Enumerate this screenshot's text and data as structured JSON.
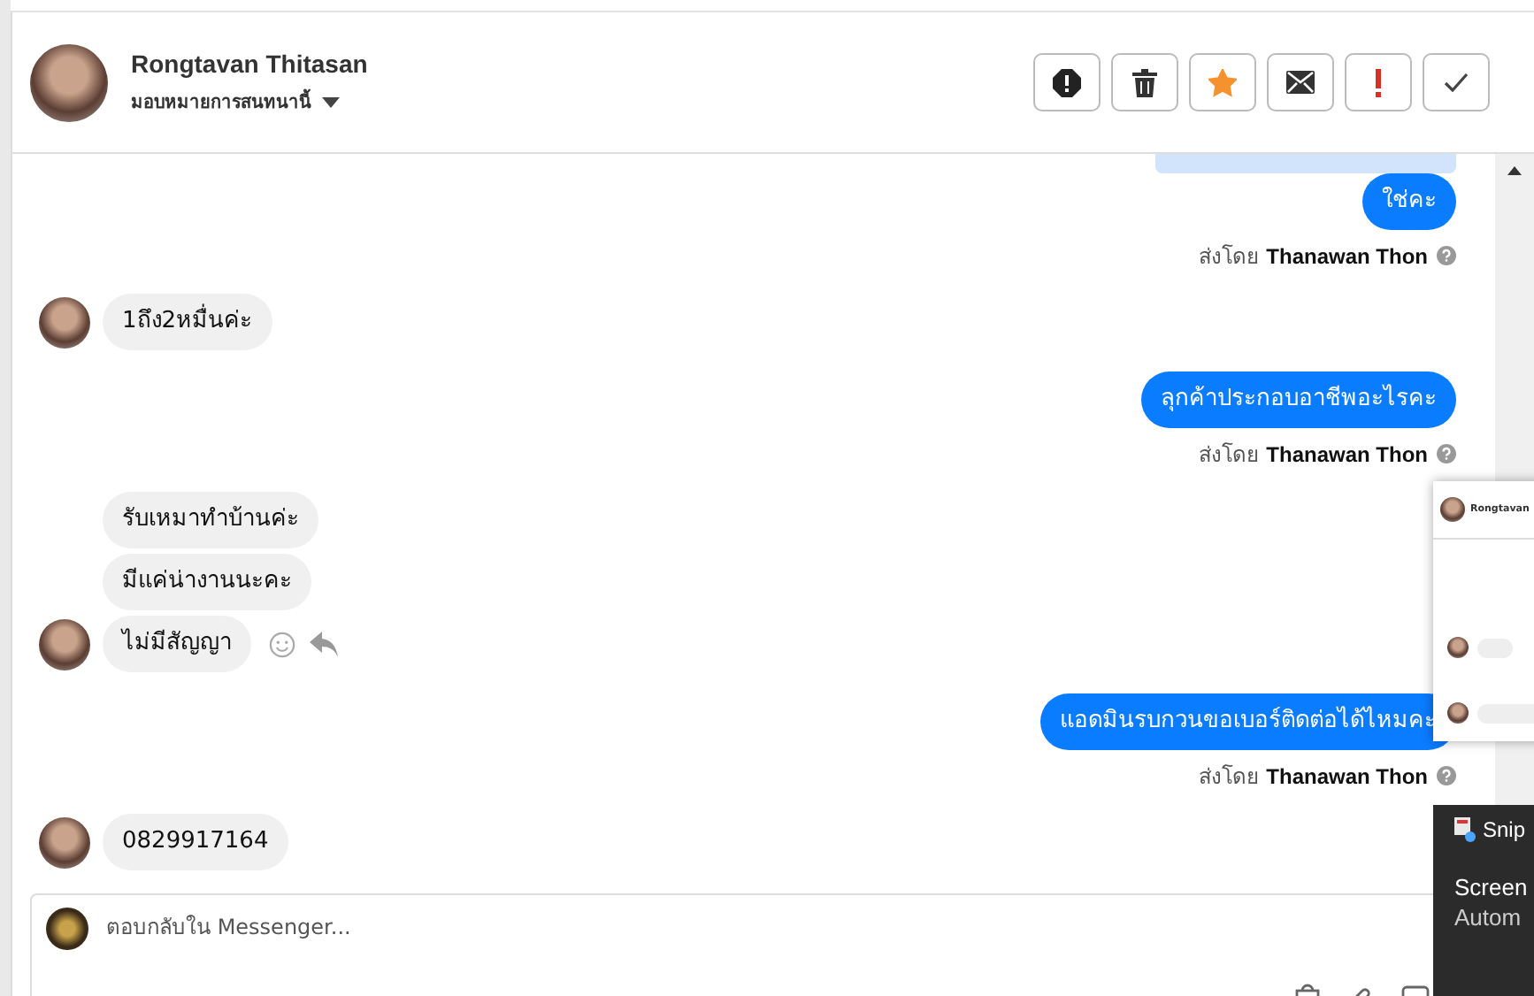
{
  "header": {
    "name": "Rongtavan Thitasan",
    "assign_label": "มอบหมายการสนทนานี้"
  },
  "toolbar": [
    {
      "kind": "spam"
    },
    {
      "kind": "trash"
    },
    {
      "kind": "star",
      "on": true
    },
    {
      "kind": "mail"
    },
    {
      "kind": "important"
    },
    {
      "kind": "done"
    }
  ],
  "messages": [
    {
      "kind": "out",
      "text": "ใช่คะ",
      "sent_by": {
        "label": "ส่งโดย",
        "name": "Thanawan Thon"
      }
    },
    {
      "kind": "in",
      "text": "1ถึง2หมื่นค่ะ",
      "avatar": true
    },
    {
      "kind": "out",
      "text": "ลุกค้าประกอบอาชีพอะไรคะ",
      "sent_by": {
        "label": "ส่งโดย",
        "name": "Thanawan Thon"
      }
    },
    {
      "kind": "in",
      "text": "รับเหมาทำบ้านค่ะ",
      "avatar": false
    },
    {
      "kind": "in",
      "text": "มีแค่น่างานนะคะ",
      "avatar": false
    },
    {
      "kind": "in",
      "text": "ไม่มีสัญญา",
      "avatar": true,
      "actions": true
    },
    {
      "kind": "out",
      "text": "แอดมินรบกวนขอเบอร์ติดต่อได้ไหมคะ",
      "sent_by": {
        "label": "ส่งโดย",
        "name": "Thanawan Thon"
      }
    },
    {
      "kind": "in",
      "text": "0829917164",
      "avatar": true
    }
  ],
  "composer": {
    "placeholder": "ตอบกลับใน Messenger..."
  },
  "overlay": {
    "thumbnail_name": "Rongtavan",
    "toast_app": "Snip",
    "toast_title": "Screen",
    "toast_text": "Autom"
  }
}
